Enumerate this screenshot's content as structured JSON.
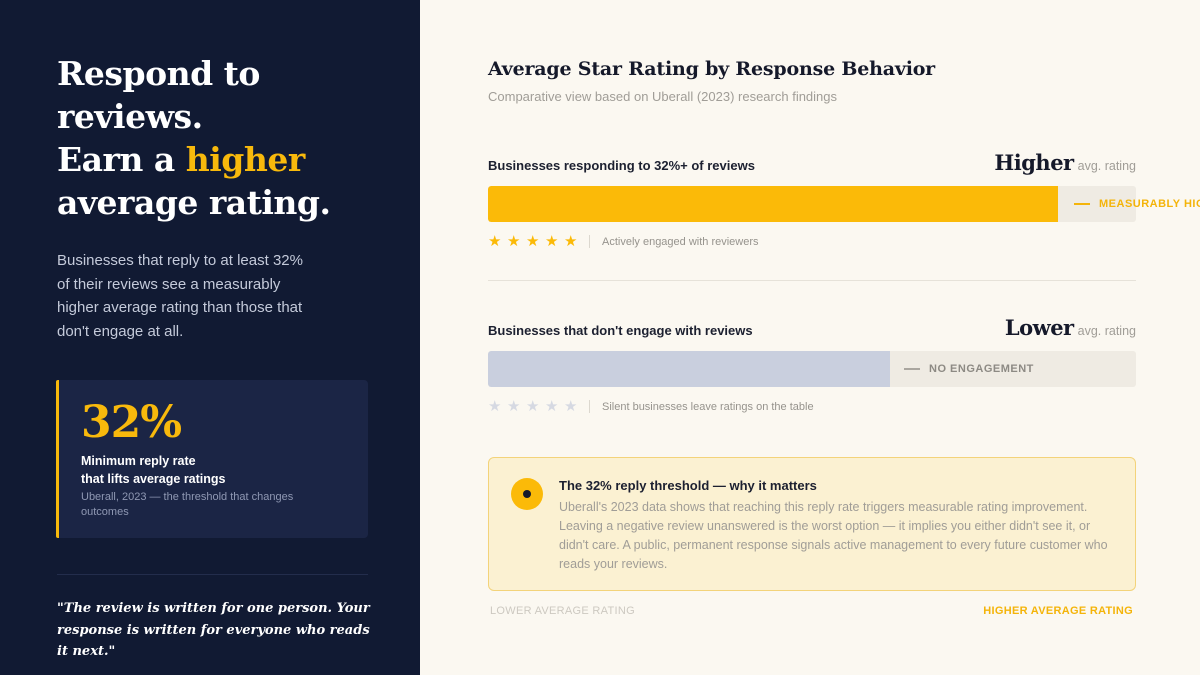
{
  "left": {
    "headline_line1": "Respond to",
    "headline_line2": "reviews.",
    "headline_line3_pre": "Earn a ",
    "headline_line3_highlight": "higher",
    "headline_line4": "average rating.",
    "lead": "Businesses that reply to at least 32% of their reviews see a measurably higher average rating than those that don't engage at all.",
    "stat": {
      "value": "32%",
      "label_line1": "Minimum reply rate",
      "label_line2": "that lifts average ratings",
      "source": "Uberall, 2023 — the threshold that changes outcomes"
    },
    "quote": "\"The review is written for one person. Your response is written for everyone who reads it next.\""
  },
  "colors": {
    "accent": "#fbba08",
    "navy": "#111a33",
    "muted_bar": "#c9cfde"
  },
  "chart_data": {
    "type": "bar",
    "orientation": "horizontal",
    "title": "Average Star Rating by Response Behavior",
    "subtitle": "Comparative view based on Uberall (2023) research findings",
    "value_unit": "avg. rating",
    "xlim": [
      0,
      1
    ],
    "x_axis_min_label": "LOWER AVERAGE RATING",
    "x_axis_max_label": "HIGHER AVERAGE RATING",
    "categories": [
      "Businesses responding to 32%+ of reviews",
      "Businesses that don't engage with reviews"
    ],
    "values": [
      0.88,
      0.62
    ],
    "value_labels": [
      "Higher",
      "Lower"
    ],
    "bar_tags": [
      "MEASURABLY HIGHER",
      "NO ENGAGEMENT"
    ],
    "stars_filled": [
      5,
      0
    ],
    "stars_total": 5,
    "star_notes": [
      "Actively engaged with reviewers",
      "Silent businesses leave ratings on the table"
    ],
    "grid": false,
    "legend": "none"
  },
  "callout": {
    "title": "The 32% reply threshold — why it matters",
    "body": "Uberall's 2023 data shows that reaching this reply rate triggers measurable rating improvement. Leaving a negative review unanswered is the worst option — it implies you either didn't see it, or didn't care. A public, permanent response signals active management to every future customer who reads your reviews."
  }
}
